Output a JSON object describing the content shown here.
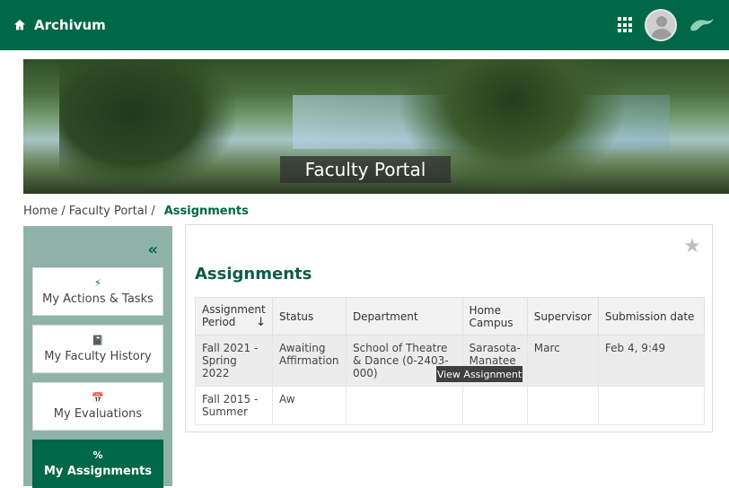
{
  "header": {
    "brand": "Archivum",
    "colors": {
      "brand": "#006747"
    },
    "icons": {
      "home": "home-icon",
      "apps": "apps-grid-icon",
      "avatar": "avatar",
      "logo": "bull-logo-icon"
    }
  },
  "banner": {
    "title": "Faculty Portal"
  },
  "breadcrumb": {
    "home": "Home",
    "faculty": "Faculty Portal",
    "current": "Assignments"
  },
  "sidebar": {
    "collapse": "«",
    "items": [
      {
        "icon": "⚡",
        "label": "My Actions & Tasks"
      },
      {
        "icon": "📓",
        "label": "My Faculty History"
      },
      {
        "icon": "📅",
        "label": "My Evaluations"
      },
      {
        "icon": "%",
        "label": "My Assignments",
        "active": true
      }
    ]
  },
  "main": {
    "title": "Assignments",
    "favorite_icon": "star-icon",
    "table": {
      "columns": [
        "Assignment Period",
        "Status",
        "Department",
        "Home Campus",
        "Supervisor",
        "Submission date"
      ],
      "rows": [
        [
          "Fall 2021 - Spring 2022",
          "Awaiting Affirmation",
          "School of Theatre & Dance (0-2403-000)",
          "Sarasota-Manatee",
          "Marc",
          "Feb 4, 9:49"
        ],
        [
          "Fall 2015 - Summer",
          "Aw",
          "",
          "",
          "",
          ""
        ]
      ]
    },
    "view_button": "View Assignment"
  }
}
